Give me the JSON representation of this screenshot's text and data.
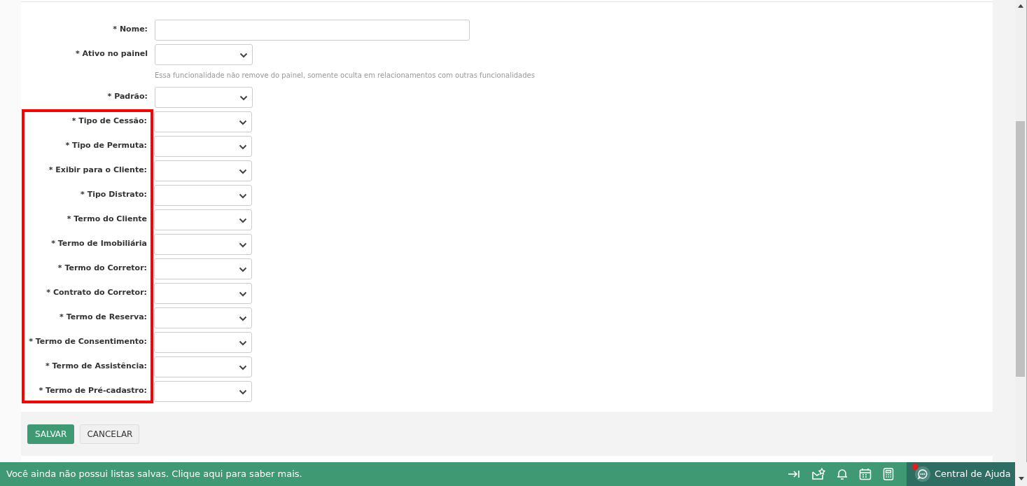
{
  "form": {
    "fields": [
      {
        "label": "* Nome:",
        "kind": "text"
      },
      {
        "label": "* Ativo no painel",
        "kind": "select",
        "help": "Essa funcionalidade não remove do painel, somente oculta em relacionamentos com outras funcionalidades"
      },
      {
        "label": "* Padrão:",
        "kind": "select"
      }
    ],
    "highlight_frame": {
      "fields": [
        {
          "label": "* Tipo de Cessão:",
          "kind": "select"
        },
        {
          "label": "* Tipo de Permuta:",
          "kind": "select"
        },
        {
          "label": "* Exibir para o Cliente:",
          "kind": "select"
        },
        {
          "label": "* Tipo Distrato:",
          "kind": "select"
        },
        {
          "label": "* Termo do Cliente",
          "kind": "select"
        },
        {
          "label": "* Termo de Imobiliária",
          "kind": "select"
        },
        {
          "label": "* Termo do Corretor:",
          "kind": "select"
        },
        {
          "label": "* Contrato do Corretor:",
          "kind": "select"
        },
        {
          "label": "* Termo de Reserva:",
          "kind": "select"
        },
        {
          "label": "* Termo de Consentimento:",
          "kind": "select"
        },
        {
          "label": "* Termo de Assistência:",
          "kind": "select"
        },
        {
          "label": "* Termo de Pré-cadastro:",
          "kind": "select"
        }
      ]
    },
    "buttons": [
      {
        "label": "SALVAR",
        "kind": "primary"
      },
      {
        "label": "CANCELAR",
        "kind": "secondary"
      }
    ]
  },
  "status_bar": {
    "message": "Você ainda não possui listas salvas. Clique aqui para saber mais.",
    "help": {
      "label": "Central de Ajuda",
      "notification": true
    }
  }
}
